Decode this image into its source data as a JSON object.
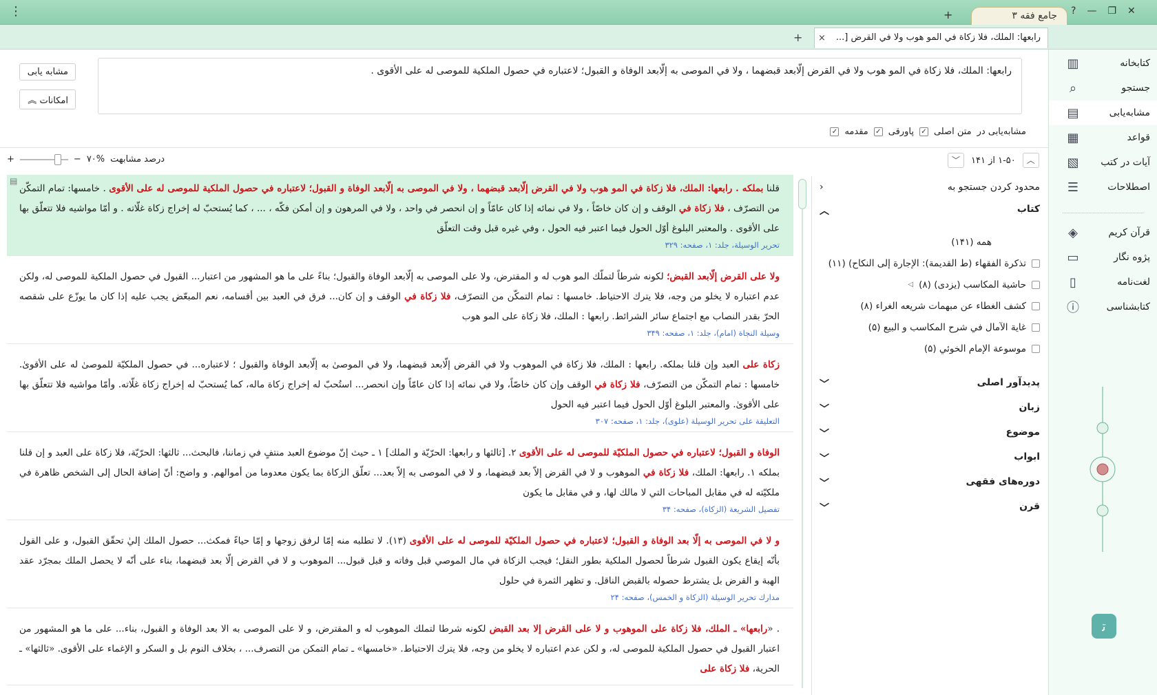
{
  "window": {
    "app_tab_title": "جامع فقه ۳",
    "help": "?",
    "minimize": "—",
    "restore": "❐",
    "close": "✕",
    "menu": "⋮",
    "new_tab": "+"
  },
  "doc_tab": {
    "title": "رابعها: الملك، فلا زكاة في المو هوب ولا في القرض [...",
    "close": "×",
    "add": "+"
  },
  "query": {
    "text": "رابعها: الملك، فلا زكاة في المو هوب ولا في القرض إلّابعد قبضهما ، ولا في الموصى به إلّابعد الوفاة و القبول؛ لاعتباره في حصول الملكية للموصى له على الأقوى ."
  },
  "buttons": {
    "similar": "مشابه یابی",
    "options": "امکانات"
  },
  "search_options": {
    "label": "مشابه‌یابی در",
    "main_text": "متن اصلی",
    "footnote": "پاورقی",
    "intro": "مقدمه"
  },
  "similarity": {
    "label": "درصد مشابهت",
    "value": "۷۰%",
    "level": 0.7,
    "minus": "−",
    "plus": "+"
  },
  "pager": {
    "text": "۱-۵۰ از ۱۴۱"
  },
  "results": [
    {
      "text_a": "قلنا ",
      "hl_a": "بملكه . رابعها: الملك، فلا زكاة في المو هوب ولا في القرض إلّابعد قبضهما ، ولا في الموصى به إلّابعد الوفاة و القبول؛ لاعتباره في حصول الملكية للموصى له على الأقوى",
      "text_b": " . خامسها: تمام التمكّن من التصرّف ، ",
      "hl_b": "فلا زكاة في",
      "text_c": " الوقف و إن كان خاصّاً ، ولا في نمائه إذا كان عامّاً و إن انحصر في واحد ، ولا في المرهون و إن أمكن فكّه ، ... ، كما يُستحبّ له إخراج زكاة غلّاته . و أمّا مواشيه فلا تتعلّق بها على الأقوى . والمعتبر البلوغ أوّل الحول فيما اعتبر فيه الحول ، وفي غيره قبل وقت التعلّق",
      "source": "تحریر الوسیلة، جلد: ۱، صفحه: ۳۲۹"
    },
    {
      "text_a": "",
      "hl_a": "ولا على القرض إلّابعد القبض؛",
      "text_b": " لكونه شرطاً لتملّك المو هوب له و المقترض، ولا على الموصى به إلّابعد الوفاة والقبول؛ بناءً على ما هو المشهور من اعتبار... القبول في حصول الملكية للموصى له، ولكن عدم اعتباره لا يخلو من وجه، فلا يترك الاحتياط. خامسها : تمام التمكّن من التصرّف، ",
      "hl_b": "فلا زكاة في",
      "text_c": " الوقف و إن كان... فرق في العبد بين أقسامه، نعم المبعّض يجب عليه إذا كان ما يوزّع على شقصه الحرّ بقدر النصاب مع اجتماع سائر الشرائط. رابعها : الملك، فلا زكاة على المو هوب",
      "source": "وسیلة النجاة (امام)، جلد: ۱، صفحه: ۳۴۹"
    },
    {
      "text_a": "",
      "hl_a": "زكاة على",
      "text_b": " العبد وإن قلنا بملكه. رابعها : الملك، فلا زكاة في الموهوب ولا في القرض إلّابعد قبضهما، ولا في الموصىٰ به إلّابعد الوفاة والقبول ؛ لاعتباره... في حصول الملكيّة للموصىٰ له على الأقوىٰ. خامسها : تمام التمكّن من التصرّف، ",
      "hl_b": "فلا زكاة في",
      "text_c": " الوقف وإن كان خاصّاً، ولا في نمائه إذا كان عامّاً وإن انحصر... استُحبّ له إخراج زكاة ماله، كما يُستحبّ له إخراج زكاة غلّاته. وأمّا مواشيه فلا تتعلّق بها على الأقوىٰ. والمعتبر البلوغ أوّل الحول فيما اعتبر فيه الحول",
      "source": "التعلیقة علی تحریر الوسیلة (علوی)، جلد: ۱، صفحه: ۳۰۷"
    },
    {
      "text_a": "",
      "hl_a": "الوفاة و القبول؛ لاعتباره في حصول الملكيّة للموصى له على الأقوى",
      "text_b": " ٢. [ثالثها و رابعها: الحرّيّة و الملك] ١ ـ حيث إنّ موضوع العبد منتفٍ في زماننا، فالبحث... ثالثها: الحرّيّة، فلا زكاة على العبد و إن قلنا بملكه ١. رابعها: الملك، ",
      "hl_b": "فلا زكاة في",
      "text_c": " الموهوب و لا في القرض إلاّ بعد قبضهما، و لا في الموصى به إلاّ بعد... تعلّق الزكاة بما يكون معدوما من أموالهم. و واضح: أنّ إضافة الحال إلى الشخص ظاهرة في ملكيّته له في مقابل المباحات التي لا مالك لها، و في مقابل ما يكون",
      "source": "تفصیل الشریعة (الزكاة)، صفحه: ۳۴"
    },
    {
      "text_a": "",
      "hl_a": "و لا في الموصى به إلّا بعد الوفاة و القبول؛ لاعتباره في حصول الملكيّة للموصى له على الأقوى",
      "text_b": " (١٣). لا تطلبه منه إمّا لرفق زوجها و إمّا حياءً فمكث... حصول الملك إليٰ تحقّق القبول، و على القول بأنّه إيقاع يكون القبول شرطاً لحصول الملكية بطور النقل؛ فيجب الزكاة في مال الموصي قبل وفاته و قبل قبول... الموهوب و لا في القرض إلّا بعد قبضهما، بناء على أنّه لا يحصل الملك بمجرّد عقد الهبة و القرض بل يشترط حصوله بالقبض الناقل. و تظهر الثمرة في حلول",
      "hl_b": "",
      "text_c": "",
      "source": "مدارك تحریر الوسیلة (الزكاة و الخمس)، صفحه: ۲۴"
    },
    {
      "text_a": ". «",
      "hl_a": "رابعها» ـ الملك، فلا زكاة على الموهوب و لا على القرض إلا بعد القبض",
      "text_b": " لكونه شرطا لتملك الموهوب له و المقترض، و لا على الموصى به الا بعد الوفاة و القبول، بناء... على ما هو المشهور من اعتبار القبول في حصول الملكية للموصى له، و لكن عدم اعتباره لا يخلو من وجه، فلا يترك الاحتياط. «خامسها» ـ تمام التمكن من التصرف... ، بخلاف النوم بل و السكر و الإغماء على الأقوى. «ثالثها» ـ الحرية، ",
      "hl_b": "فلا زكاة على",
      "text_c": "",
      "source": ""
    }
  ],
  "filter": {
    "title": "محدود کردن جستجو به",
    "books_section": "کتاب",
    "all": "همه (۱۴۱)",
    "books": [
      "تذكرة الفقهاء (ط القديمة): الإجارة إلى النكاح) (۱۱)",
      "حاشية المكاسب (يزدى) (۸)",
      "كشف الغطاء عن مبهمات شريعه الغراء (۸)",
      "غاية الآمال في شرح المكاسب و البيع (۵)",
      "موسوعة الإمام الخوئي (۵)"
    ],
    "sections": [
      "پدیدآور اصلی",
      "زبان",
      "موضوع",
      "ابواب",
      "دوره‌های فقهی",
      "قرن"
    ]
  },
  "sidebar": {
    "items": [
      {
        "label": "کتابخانه",
        "icon": "library-icon"
      },
      {
        "label": "جستجو",
        "icon": "search-icon"
      },
      {
        "label": "مشابه‌یابی",
        "icon": "similar-icon"
      },
      {
        "label": "قواعد",
        "icon": "rules-icon"
      },
      {
        "label": "آیات در کتب",
        "icon": "verses-icon"
      },
      {
        "label": "اصطلاحات",
        "icon": "terms-icon"
      }
    ],
    "items2": [
      {
        "label": "قرآن کریم",
        "icon": "quran-icon"
      },
      {
        "label": "پژوه نگار",
        "icon": "notes-icon"
      },
      {
        "label": "لغت‌نامه",
        "icon": "dictionary-icon"
      },
      {
        "label": "کتابشناسی",
        "icon": "bibliography-icon"
      }
    ]
  }
}
